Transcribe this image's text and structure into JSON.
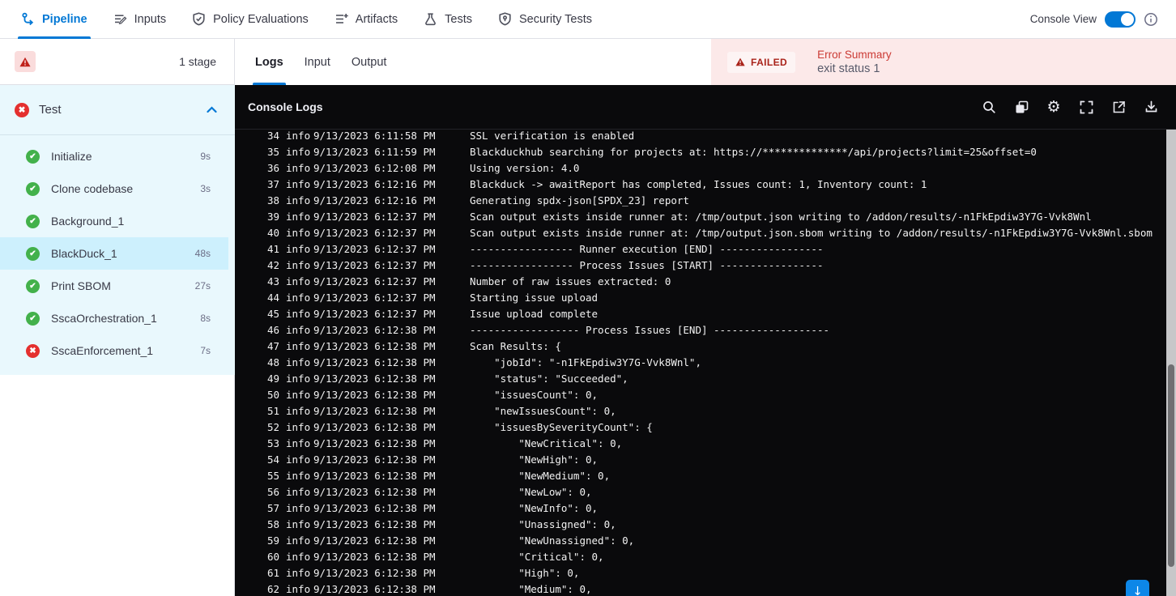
{
  "nav": {
    "tabs": [
      {
        "label": "Pipeline"
      },
      {
        "label": "Inputs"
      },
      {
        "label": "Policy Evaluations"
      },
      {
        "label": "Artifacts"
      },
      {
        "label": "Tests"
      },
      {
        "label": "Security Tests"
      }
    ],
    "console_view_label": "Console View",
    "console_view_on": true
  },
  "sidebar": {
    "stage_count": "1 stage",
    "stage_name": "Test",
    "stage_status": "failed",
    "steps": [
      {
        "name": "Initialize",
        "duration": "9s",
        "status": "success",
        "selected": false
      },
      {
        "name": "Clone codebase",
        "duration": "3s",
        "status": "success",
        "selected": false
      },
      {
        "name": "Background_1",
        "duration": "",
        "status": "success",
        "selected": false
      },
      {
        "name": "BlackDuck_1",
        "duration": "48s",
        "status": "success",
        "selected": true
      },
      {
        "name": "Print SBOM",
        "duration": "27s",
        "status": "success",
        "selected": false
      },
      {
        "name": "SscaOrchestration_1",
        "duration": "8s",
        "status": "success",
        "selected": false
      },
      {
        "name": "SscaEnforcement_1",
        "duration": "7s",
        "status": "failed",
        "selected": false
      }
    ]
  },
  "main": {
    "tabs": [
      "Logs",
      "Input",
      "Output"
    ],
    "active_tab": "Logs",
    "failed_label": "FAILED",
    "error_title": "Error Summary",
    "error_text": "exit status 1"
  },
  "console": {
    "title": "Console Logs",
    "actions": [
      "search",
      "copy",
      "settings",
      "fullscreen",
      "open-in-new-tab",
      "download"
    ],
    "lines": [
      {
        "n": "34",
        "level": "info",
        "ts": "9/13/2023 6:11:58 PM",
        "msg": "SSL verification is enabled"
      },
      {
        "n": "35",
        "level": "info",
        "ts": "9/13/2023 6:11:59 PM",
        "msg": "Blackduckhub searching for projects at: https://**************/api/projects?limit=25&offset=0"
      },
      {
        "n": "36",
        "level": "info",
        "ts": "9/13/2023 6:12:08 PM",
        "msg": "Using version: 4.0"
      },
      {
        "n": "37",
        "level": "info",
        "ts": "9/13/2023 6:12:16 PM",
        "msg": "Blackduck -> awaitReport has completed, Issues count: 1, Inventory count: 1"
      },
      {
        "n": "38",
        "level": "info",
        "ts": "9/13/2023 6:12:16 PM",
        "msg": "Generating spdx-json[SPDX_23] report"
      },
      {
        "n": "39",
        "level": "info",
        "ts": "9/13/2023 6:12:37 PM",
        "msg": "Scan output exists inside runner at: /tmp/output.json writing to /addon/results/-n1FkEpdiw3Y7G-Vvk8Wnl"
      },
      {
        "n": "40",
        "level": "info",
        "ts": "9/13/2023 6:12:37 PM",
        "msg": "Scan output exists inside runner at: /tmp/output.json.sbom writing to /addon/results/-n1FkEpdiw3Y7G-Vvk8Wnl.sbom"
      },
      {
        "n": "41",
        "level": "info",
        "ts": "9/13/2023 6:12:37 PM",
        "msg": "----------------- Runner execution [END] -----------------"
      },
      {
        "n": "42",
        "level": "info",
        "ts": "9/13/2023 6:12:37 PM",
        "msg": "----------------- Process Issues [START] -----------------"
      },
      {
        "n": "43",
        "level": "info",
        "ts": "9/13/2023 6:12:37 PM",
        "msg": "Number of raw issues extracted: 0"
      },
      {
        "n": "44",
        "level": "info",
        "ts": "9/13/2023 6:12:37 PM",
        "msg": "Starting issue upload"
      },
      {
        "n": "45",
        "level": "info",
        "ts": "9/13/2023 6:12:37 PM",
        "msg": "Issue upload complete"
      },
      {
        "n": "46",
        "level": "info",
        "ts": "9/13/2023 6:12:38 PM",
        "msg": "------------------ Process Issues [END] -------------------"
      },
      {
        "n": "47",
        "level": "info",
        "ts": "9/13/2023 6:12:38 PM",
        "msg": "Scan Results: {"
      },
      {
        "n": "48",
        "level": "info",
        "ts": "9/13/2023 6:12:38 PM",
        "msg": "    \"jobId\": \"-n1FkEpdiw3Y7G-Vvk8Wnl\","
      },
      {
        "n": "49",
        "level": "info",
        "ts": "9/13/2023 6:12:38 PM",
        "msg": "    \"status\": \"Succeeded\","
      },
      {
        "n": "50",
        "level": "info",
        "ts": "9/13/2023 6:12:38 PM",
        "msg": "    \"issuesCount\": 0,"
      },
      {
        "n": "51",
        "level": "info",
        "ts": "9/13/2023 6:12:38 PM",
        "msg": "    \"newIssuesCount\": 0,"
      },
      {
        "n": "52",
        "level": "info",
        "ts": "9/13/2023 6:12:38 PM",
        "msg": "    \"issuesBySeverityCount\": {"
      },
      {
        "n": "53",
        "level": "info",
        "ts": "9/13/2023 6:12:38 PM",
        "msg": "        \"NewCritical\": 0,"
      },
      {
        "n": "54",
        "level": "info",
        "ts": "9/13/2023 6:12:38 PM",
        "msg": "        \"NewHigh\": 0,"
      },
      {
        "n": "55",
        "level": "info",
        "ts": "9/13/2023 6:12:38 PM",
        "msg": "        \"NewMedium\": 0,"
      },
      {
        "n": "56",
        "level": "info",
        "ts": "9/13/2023 6:12:38 PM",
        "msg": "        \"NewLow\": 0,"
      },
      {
        "n": "57",
        "level": "info",
        "ts": "9/13/2023 6:12:38 PM",
        "msg": "        \"NewInfo\": 0,"
      },
      {
        "n": "58",
        "level": "info",
        "ts": "9/13/2023 6:12:38 PM",
        "msg": "        \"Unassigned\": 0,"
      },
      {
        "n": "59",
        "level": "info",
        "ts": "9/13/2023 6:12:38 PM",
        "msg": "        \"NewUnassigned\": 0,"
      },
      {
        "n": "60",
        "level": "info",
        "ts": "9/13/2023 6:12:38 PM",
        "msg": "        \"Critical\": 0,"
      },
      {
        "n": "61",
        "level": "info",
        "ts": "9/13/2023 6:12:38 PM",
        "msg": "        \"High\": 0,"
      },
      {
        "n": "62",
        "level": "info",
        "ts": "9/13/2023 6:12:38 PM",
        "msg": "        \"Medium\": 0,"
      }
    ]
  },
  "colors": {
    "accent_blue": "#0278d5",
    "success_green": "#43b14b",
    "error_red": "#e4302f",
    "failed_text_red": "#a9231a",
    "error_pink_bg": "#fce9e9",
    "sidebar_cyan_bg": "#e9f8fd",
    "selected_step_bg": "#cdf0fd",
    "console_bg": "#0a0a0c"
  }
}
